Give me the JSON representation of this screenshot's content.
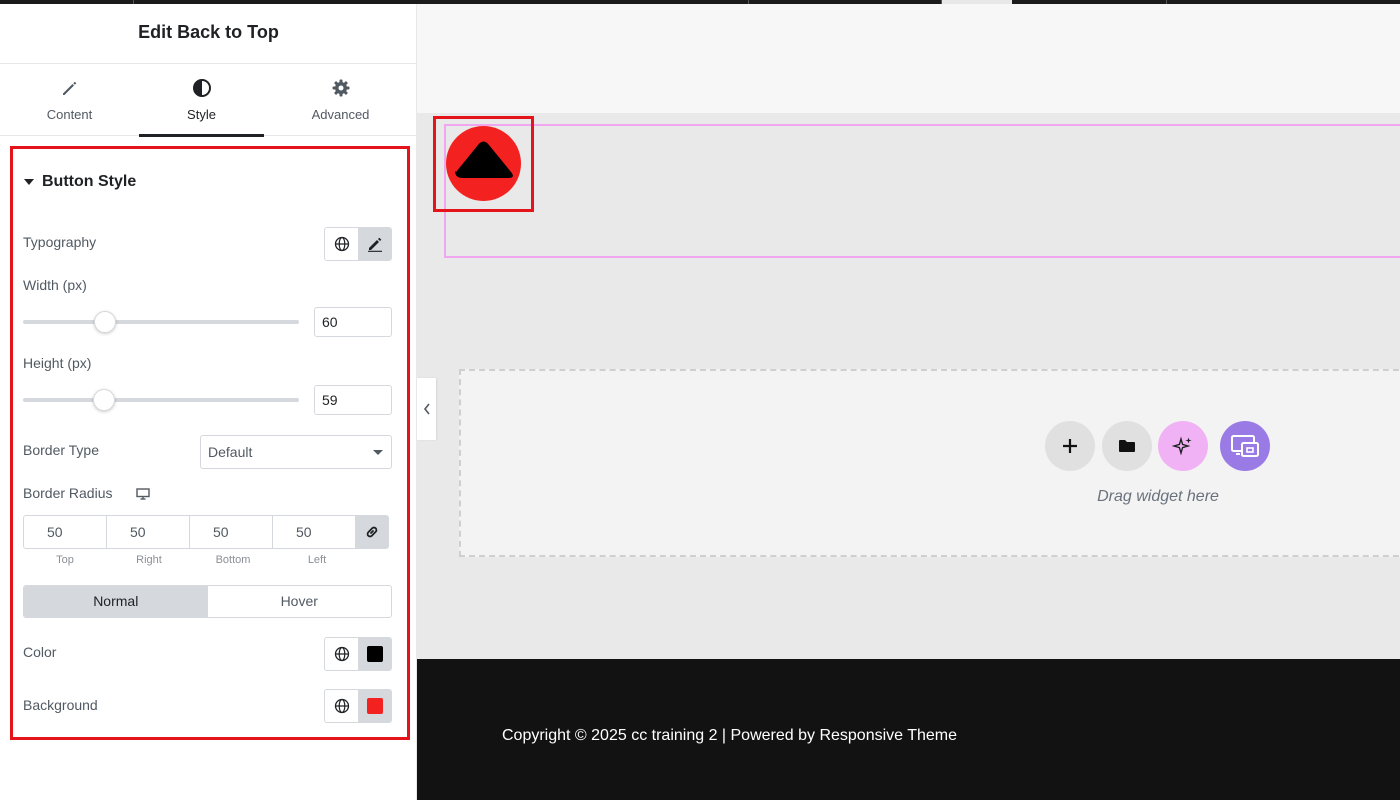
{
  "panel": {
    "title": "Edit Back to Top",
    "tabs": [
      {
        "label": "Content",
        "icon": "pencil-icon"
      },
      {
        "label": "Style",
        "icon": "half-circle-icon",
        "active": true
      },
      {
        "label": "Advanced",
        "icon": "gear-icon"
      }
    ],
    "section_title": "Button Style",
    "typography_label": "Typography",
    "width": {
      "label": "Width (px)",
      "value": "60",
      "slider_fraction": 0.3
    },
    "height": {
      "label": "Height (px)",
      "value": "59",
      "slider_fraction": 0.295
    },
    "border_type": {
      "label": "Border Type",
      "selected": "Default"
    },
    "border_radius": {
      "label": "Border Radius",
      "device_icon": "desktop-icon",
      "values": [
        "50",
        "50",
        "50",
        "50"
      ],
      "sides": [
        "Top",
        "Right",
        "Bottom",
        "Left"
      ],
      "linked": true
    },
    "state_tabs": {
      "normal": "Normal",
      "hover": "Hover",
      "active": "Normal"
    },
    "color": {
      "label": "Color",
      "value": "#000000"
    },
    "background": {
      "label": "Background",
      "value": "#f42121"
    }
  },
  "canvas": {
    "drag_text": "Drag widget here",
    "dropzone_buttons": [
      "add-icon",
      "folder-icon",
      "ai-sparkle-icon",
      "template-kit-icon"
    ],
    "button_color": "#f42121",
    "arrow_color": "#000000"
  },
  "footer": {
    "copyright": "Copyright © 2025 cc training 2 | Powered by Responsive Theme"
  },
  "colors": {
    "accent_red": "#e4141a",
    "widget_outline": "#f0a7f0",
    "ai_button": "#f0b2f4",
    "kit_button": "#9a7be6"
  }
}
